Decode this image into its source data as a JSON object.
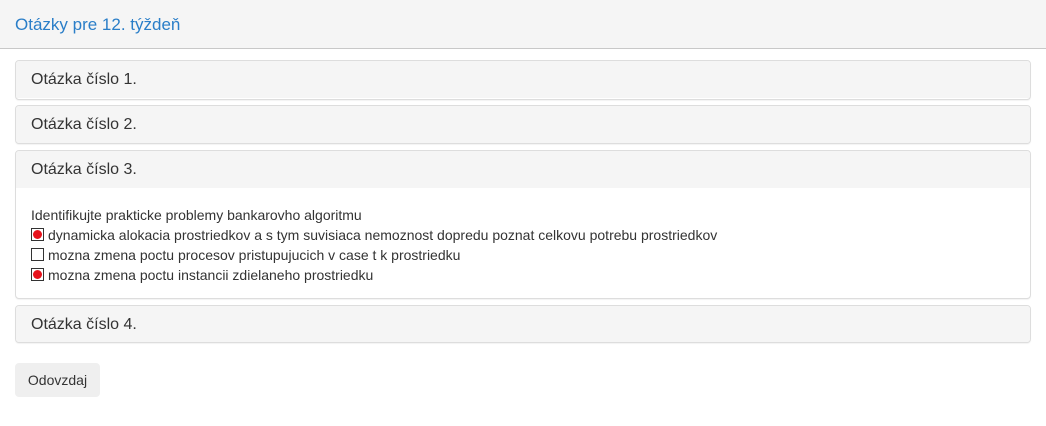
{
  "page": {
    "title": "Otázky pre 12. týždeň"
  },
  "questions": [
    {
      "label": "Otázka číslo 1.",
      "expanded": false
    },
    {
      "label": "Otázka číslo 2.",
      "expanded": false
    },
    {
      "label": "Otázka číslo 3.",
      "expanded": true,
      "text": "Identifikujte prakticke problemy bankarovho algoritmu",
      "options": [
        {
          "label": "dynamicka alokacia prostriedkov a s tym suvisiaca nemoznost dopredu poznat celkovu potrebu prostriedkov",
          "checked": true
        },
        {
          "label": "mozna zmena poctu procesov pristupujucich v case t k prostriedku",
          "checked": false
        },
        {
          "label": "mozna zmena poctu instancii zdielaneho prostriedku",
          "checked": true
        }
      ]
    },
    {
      "label": "Otázka číslo 4.",
      "expanded": false
    }
  ],
  "actions": {
    "submit_label": "Odovzdaj"
  },
  "colors": {
    "title": "#2a7ec8",
    "checked_mark": "#e8121b",
    "panel_heading_bg": "#f5f5f5"
  }
}
